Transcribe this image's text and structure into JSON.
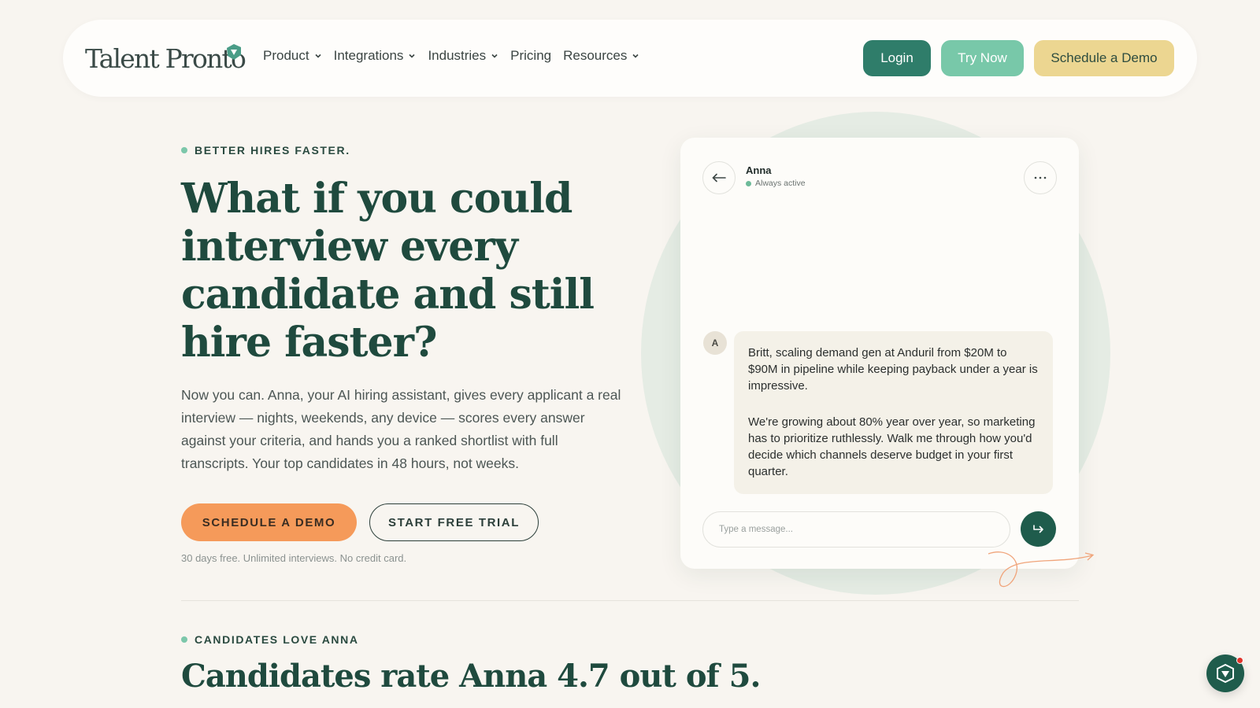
{
  "nav": {
    "logo_text": "Talent Pronto",
    "links": [
      {
        "label": "Product",
        "has_dropdown": true
      },
      {
        "label": "Integrations",
        "has_dropdown": true
      },
      {
        "label": "Industries",
        "has_dropdown": true
      },
      {
        "label": "Pricing",
        "has_dropdown": false
      },
      {
        "label": "Resources",
        "has_dropdown": true
      }
    ],
    "login_label": "Login",
    "try_label": "Try Now",
    "demo_label": "Schedule a Demo"
  },
  "hero": {
    "eyebrow": "BETTER HIRES FASTER.",
    "title": "What if you could interview every candidate and still hire faster?",
    "subtitle": "Now you can. Anna, your AI hiring assistant, gives every applicant a real interview — nights, weekends, any device — scores every answer against your criteria, and hands you a ranked shortlist with full transcripts. Your top candidates in 48 hours, not weeks.",
    "cta_primary": "SCHEDULE A DEMO",
    "cta_secondary": "START FREE TRIAL",
    "fine_print": "30 days free. Unlimited interviews. No credit card."
  },
  "chat": {
    "agent_name": "Anna",
    "agent_status": "Always active",
    "avatar_initial": "A",
    "message_paragraphs": [
      "Britt, scaling demand gen at Anduril from $20M to $90M in pipeline while keeping payback under a year is impressive.",
      "We're growing about 80% year over year, so marketing has to prioritize ruthlessly. Walk me through how you'd decide which channels deserve budget in your first quarter."
    ],
    "input_placeholder": "Type a message..."
  },
  "section2": {
    "eyebrow": "CANDIDATES LOVE ANNA",
    "title": "Candidates rate Anna 4.7 out of 5."
  },
  "colors": {
    "brand_green": "#1f4a3e",
    "login_bg": "#2f7d6a",
    "try_bg": "#78c8a9",
    "demo_bg": "#ecd691",
    "cta_orange": "#f59a5a",
    "page_bg": "#f8f5f0"
  }
}
